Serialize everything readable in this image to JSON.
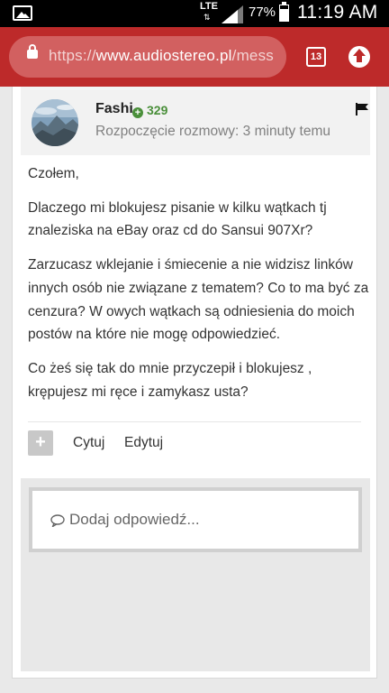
{
  "status_bar": {
    "network": "LTE",
    "battery": "77%",
    "battery_level": 0.77,
    "time": "11:19 AM"
  },
  "browser": {
    "url_scheme": "https://",
    "url_host": "www.audiostereo.pl",
    "url_path": "/mess",
    "tab_count": "13"
  },
  "message": {
    "author": "Fashi",
    "reputation": "329",
    "started": "Rozpoczęcie rozmowy: 3 minuty temu",
    "paragraphs": [
      "Czołem,",
      "Dlaczego mi blokujesz pisanie w kilku wątkach tj znaleziska na eBay oraz cd do Sansui 907Xr?",
      "Zarzucasz wklejanie i śmiecenie a nie widzisz linków innych osób nie związane z tematem?  Co to ma być za cenzura?  W owych wątkach są odniesienia do moich postów na które nie mogę odpowiedzieć.",
      "Co żeś się tak do mnie przyczepił i blokujesz , krępujesz mi ręce i zamykasz usta?"
    ]
  },
  "actions": {
    "plus": "+",
    "quote": "Cytuj",
    "edit": "Edytuj"
  },
  "reply": {
    "placeholder": "Dodaj odpowiedź..."
  },
  "colors": {
    "browser_bar": "#bd2a2a",
    "reputation": "#4a8f3a"
  }
}
